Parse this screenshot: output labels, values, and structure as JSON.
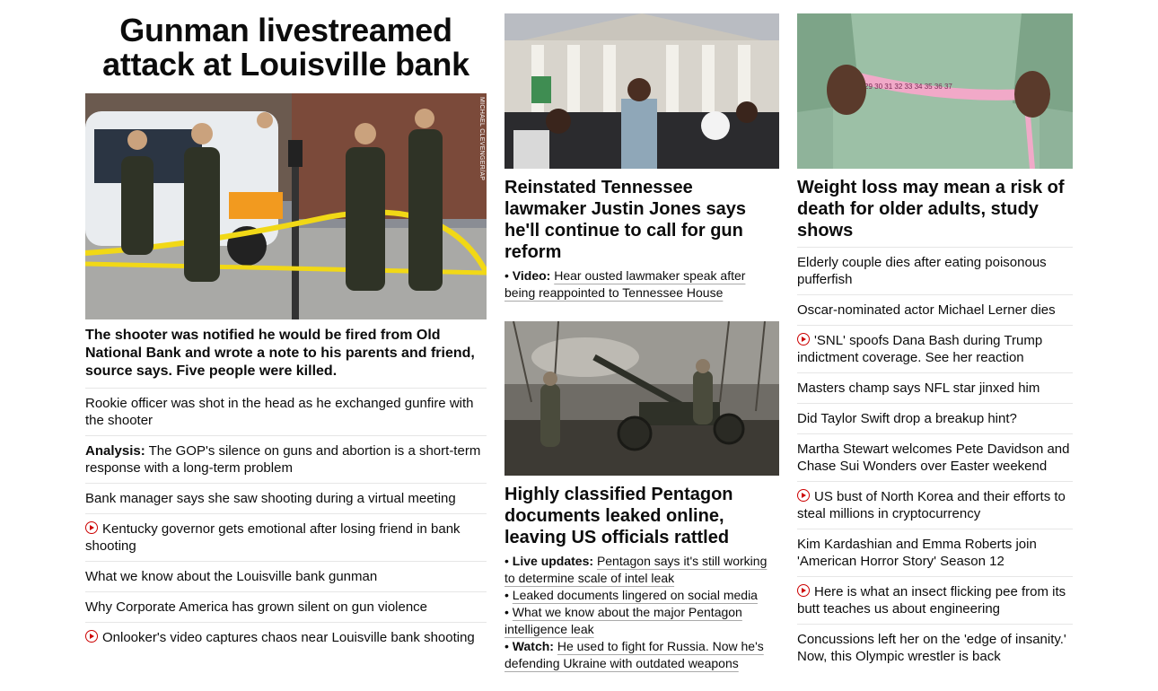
{
  "col1": {
    "title": "Gunman livestreamed attack at Louisville bank",
    "photo_credit": "MICHAEL CLEVENGER/AP",
    "summary": "The shooter was notified he would be fired from Old National Bank and wrote a note to his parents and friend, source says. Five people were killed.",
    "items": [
      {
        "prefix": "",
        "text": "Rookie officer was shot in the head as he exchanged gunfire with the shooter",
        "video": false
      },
      {
        "prefix": "Analysis:",
        "text": " The GOP's silence on guns and abortion is a short-term response with a long-term problem",
        "video": false
      },
      {
        "prefix": "",
        "text": "Bank manager says she saw shooting during a virtual meeting",
        "video": false
      },
      {
        "prefix": "",
        "text": "Kentucky governor gets emotional after losing friend in bank shooting",
        "video": true
      },
      {
        "prefix": "",
        "text": "What we know about the Louisville bank gunman",
        "video": false
      },
      {
        "prefix": "",
        "text": "Why Corporate America has grown silent on gun violence",
        "video": false
      },
      {
        "prefix": "",
        "text": "Onlooker's video captures chaos near Louisville bank shooting",
        "video": true
      }
    ]
  },
  "col2": {
    "story1": {
      "headline": "Reinstated Tennessee lawmaker Justin Jones says he'll continue to call for gun reform",
      "subs": [
        {
          "bullet": "•",
          "prefix": "Video:",
          "text": "Hear ousted lawmaker speak after being reappointed to Tennessee House"
        }
      ]
    },
    "story2": {
      "headline": "Highly classified Pentagon documents leaked online, leaving US officials rattled",
      "subs": [
        {
          "bullet": "•",
          "prefix": "Live updates:",
          "text": "Pentagon says it's still working to determine scale of intel leak"
        },
        {
          "bullet": "•",
          "prefix": "",
          "text": "Leaked documents lingered on social media"
        },
        {
          "bullet": "•",
          "prefix": "",
          "text": "What we know about the major Pentagon intelligence leak"
        },
        {
          "bullet": "•",
          "prefix": "Watch:",
          "text": "He used to fight for Russia. Now he's defending Ukraine with outdated weapons"
        }
      ]
    }
  },
  "col3": {
    "headline": "Weight loss may mean a risk of death for older adults, study shows",
    "tape_numbers": "29 30 31 32 33 34 35 36 37",
    "items": [
      {
        "text": "Elderly couple dies after eating poisonous pufferfish",
        "video": false
      },
      {
        "text": "Oscar-nominated actor Michael Lerner dies",
        "video": false
      },
      {
        "text": "'SNL' spoofs Dana Bash during Trump indictment coverage. See her reaction",
        "video": true
      },
      {
        "text": "Masters champ says NFL star jinxed him",
        "video": false
      },
      {
        "text": "Did Taylor Swift drop a breakup hint?",
        "video": false
      },
      {
        "text": "Martha Stewart welcomes Pete Davidson and Chase Sui Wonders over Easter weekend",
        "video": false
      },
      {
        "text": "US bust of North Korea and their efforts to steal millions in cryptocurrency",
        "video": true
      },
      {
        "text": "Kim Kardashian and Emma Roberts join 'American Horror Story' Season 12",
        "video": false
      },
      {
        "text": "Here is what an insect flicking pee from its butt teaches us about engineering",
        "video": true
      },
      {
        "text": "Concussions left her on the 'edge of insanity.' Now, this Olympic wrestler is back",
        "video": false
      }
    ]
  },
  "colors": {
    "text": "#0c0c0c",
    "video_red": "#cc0000",
    "divider": "#e6e6e6"
  }
}
